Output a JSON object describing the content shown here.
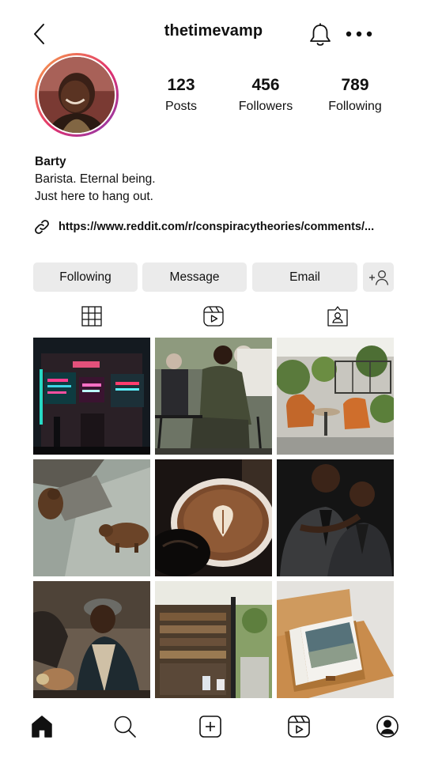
{
  "profile": {
    "username": "thetimevamp",
    "stats": [
      {
        "value": "123",
        "label": "Posts"
      },
      {
        "value": "456",
        "label": "Followers"
      },
      {
        "value": "789",
        "label": "Following"
      }
    ],
    "name": "Barty",
    "bio_line1": "Barista. Eternal being.",
    "bio_line2": "Just here to hang out.",
    "link": "https://www.reddit.com/r/conspiracytheories/comments/..."
  },
  "actions": {
    "following_label": "Following",
    "message_label": "Message",
    "email_label": "Email"
  },
  "icons": {
    "back": "chevron-left-icon",
    "notifications": "bell-icon",
    "more": "more-horizontal-icon",
    "link": "link-icon",
    "add_user": "add-user-icon",
    "grid_tab": "grid-icon",
    "reels_tab": "reels-icon",
    "tagged_tab": "tagged-user-icon",
    "nav": [
      "home-icon",
      "search-icon",
      "create-post-icon",
      "reels-icon",
      "profile-icon"
    ]
  },
  "colors": {
    "button_bg": "#ebebeb",
    "text": "#111111",
    "avatar_ring": [
      "#f7a44a",
      "#e1306c",
      "#833ab4"
    ]
  }
}
